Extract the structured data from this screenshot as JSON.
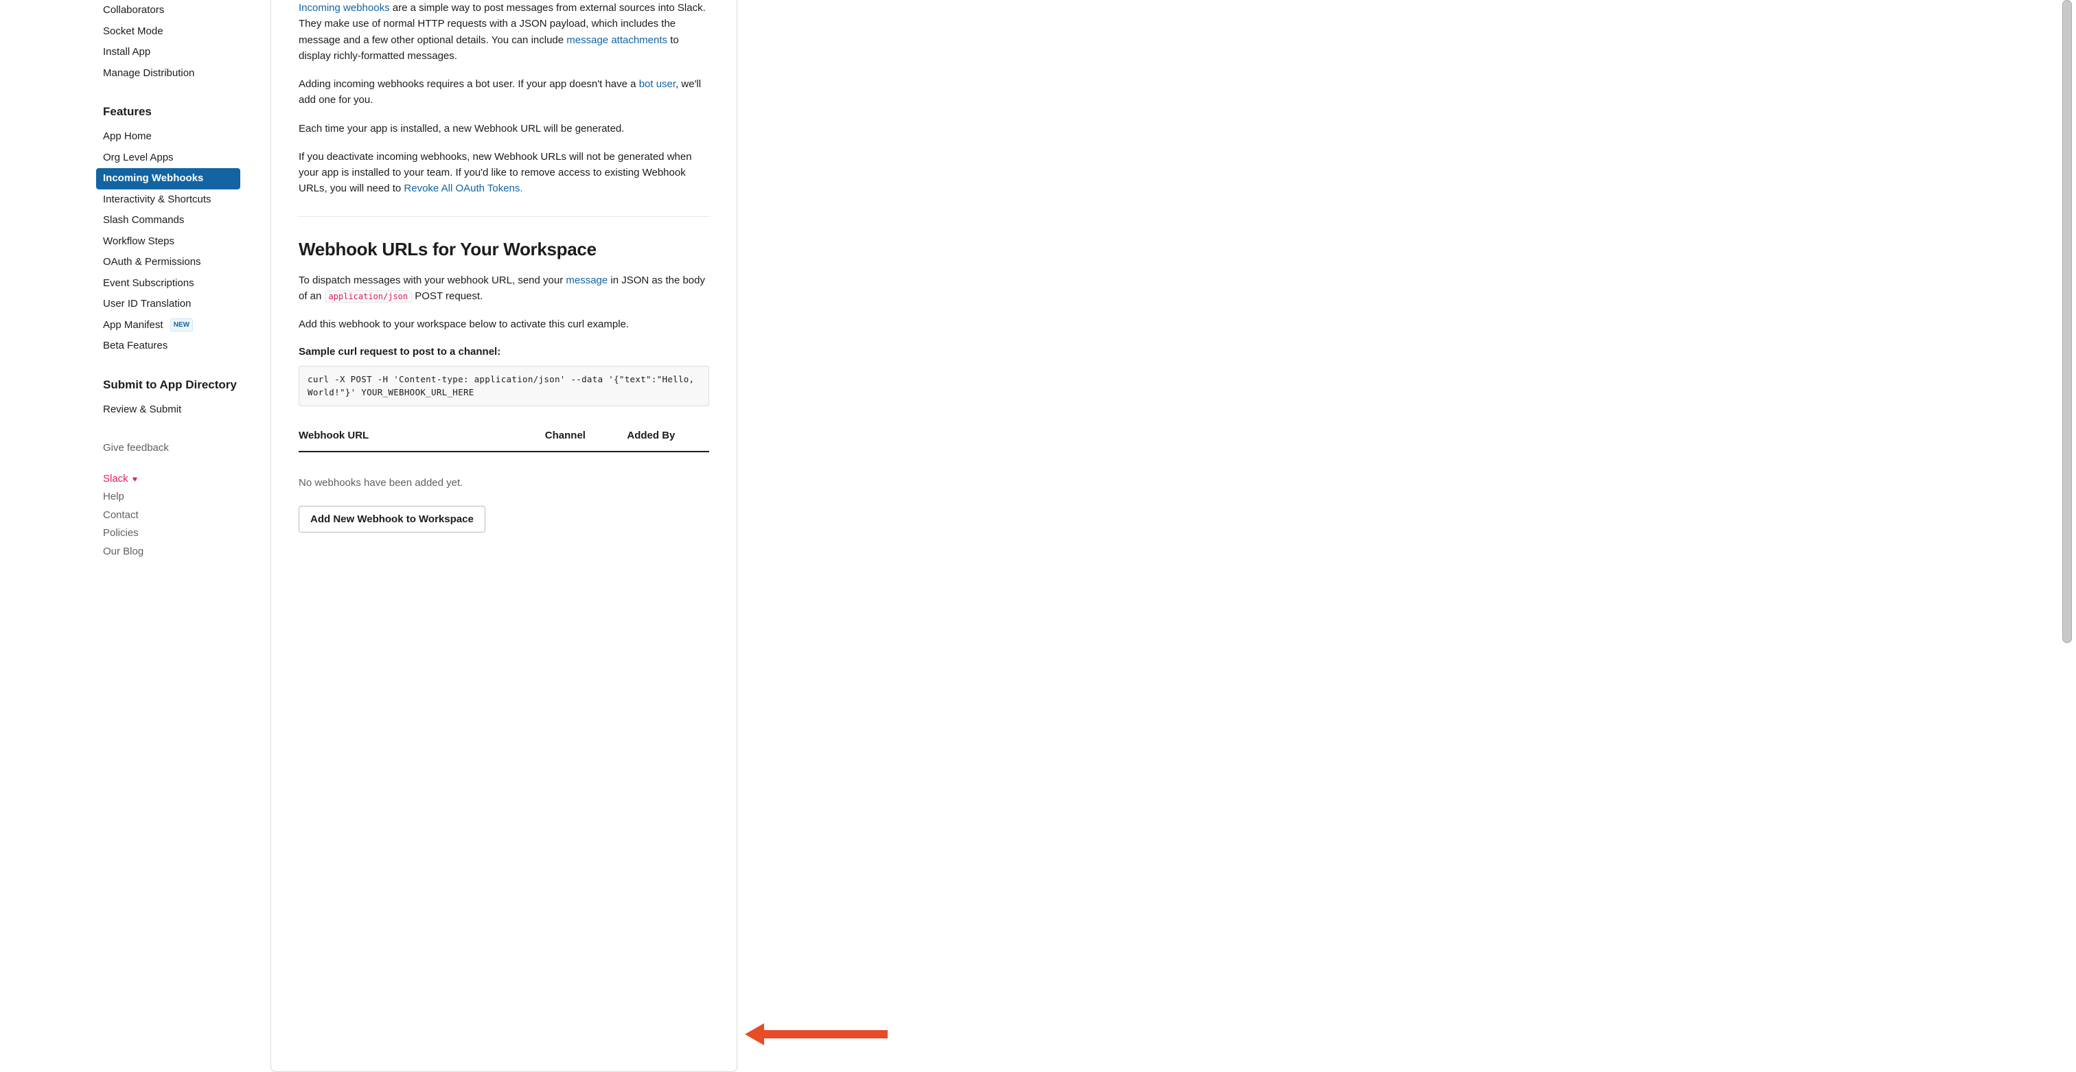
{
  "sidebar": {
    "groups": [
      {
        "heading": null,
        "items": [
          {
            "label": "Collaborators",
            "active": false,
            "badge": null
          },
          {
            "label": "Socket Mode",
            "active": false,
            "badge": null
          },
          {
            "label": "Install App",
            "active": false,
            "badge": null
          },
          {
            "label": "Manage Distribution",
            "active": false,
            "badge": null
          }
        ]
      },
      {
        "heading": "Features",
        "items": [
          {
            "label": "App Home",
            "active": false,
            "badge": null
          },
          {
            "label": "Org Level Apps",
            "active": false,
            "badge": null
          },
          {
            "label": "Incoming Webhooks",
            "active": true,
            "badge": null
          },
          {
            "label": "Interactivity & Shortcuts",
            "active": false,
            "badge": null
          },
          {
            "label": "Slash Commands",
            "active": false,
            "badge": null
          },
          {
            "label": "Workflow Steps",
            "active": false,
            "badge": null
          },
          {
            "label": "OAuth & Permissions",
            "active": false,
            "badge": null
          },
          {
            "label": "Event Subscriptions",
            "active": false,
            "badge": null
          },
          {
            "label": "User ID Translation",
            "active": false,
            "badge": null
          },
          {
            "label": "App Manifest",
            "active": false,
            "badge": "NEW"
          },
          {
            "label": "Beta Features",
            "active": false,
            "badge": null
          }
        ]
      },
      {
        "heading": "Submit to App Directory",
        "items": [
          {
            "label": "Review & Submit",
            "active": false,
            "badge": null
          }
        ]
      }
    ],
    "feedback": "Give feedback",
    "footer_links": [
      {
        "label": "Slack",
        "class": "slack",
        "heart": true
      },
      {
        "label": "Help",
        "class": "",
        "heart": false
      },
      {
        "label": "Contact",
        "class": "",
        "heart": false
      },
      {
        "label": "Policies",
        "class": "",
        "heart": false
      },
      {
        "label": "Our Blog",
        "class": "",
        "heart": false
      }
    ]
  },
  "content": {
    "p1": {
      "link1": "Incoming webhooks",
      "text1": " are a simple way to post messages from external sources into Slack. They make use of normal HTTP requests with a JSON payload, which includes the message and a few other optional details. You can include ",
      "link2": "message attachments",
      "text2": " to display richly-formatted messages."
    },
    "p2": {
      "text1": "Adding incoming webhooks requires a bot user. If your app doesn't have a ",
      "link1": "bot user",
      "text2": ", we'll add one for you."
    },
    "p3": "Each time your app is installed, a new Webhook URL will be generated.",
    "p4": {
      "text1": "If you deactivate incoming webhooks, new Webhook URLs will not be generated when your app is installed to your team. If you'd like to remove access to existing Webhook URLs, you will need to ",
      "link1": "Revoke All OAuth Tokens."
    },
    "section_heading": "Webhook URLs for Your Workspace",
    "p5": {
      "text1": "To dispatch messages with your webhook URL, send your ",
      "link1": "message",
      "text2": " in JSON as the body of an ",
      "code": "application/json",
      "text3": " POST request."
    },
    "p6": "Add this webhook to your workspace below to activate this curl example.",
    "curl_heading": "Sample curl request to post to a channel:",
    "curl_code": "curl -X POST -H 'Content-type: application/json' --data '{\"text\":\"Hello, World!\"}' YOUR_WEBHOOK_URL_HERE",
    "table": {
      "col1": "Webhook URL",
      "col2": "Channel",
      "col3": "Added By",
      "empty": "No webhooks have been added yet."
    },
    "add_button": "Add New Webhook to Workspace"
  }
}
